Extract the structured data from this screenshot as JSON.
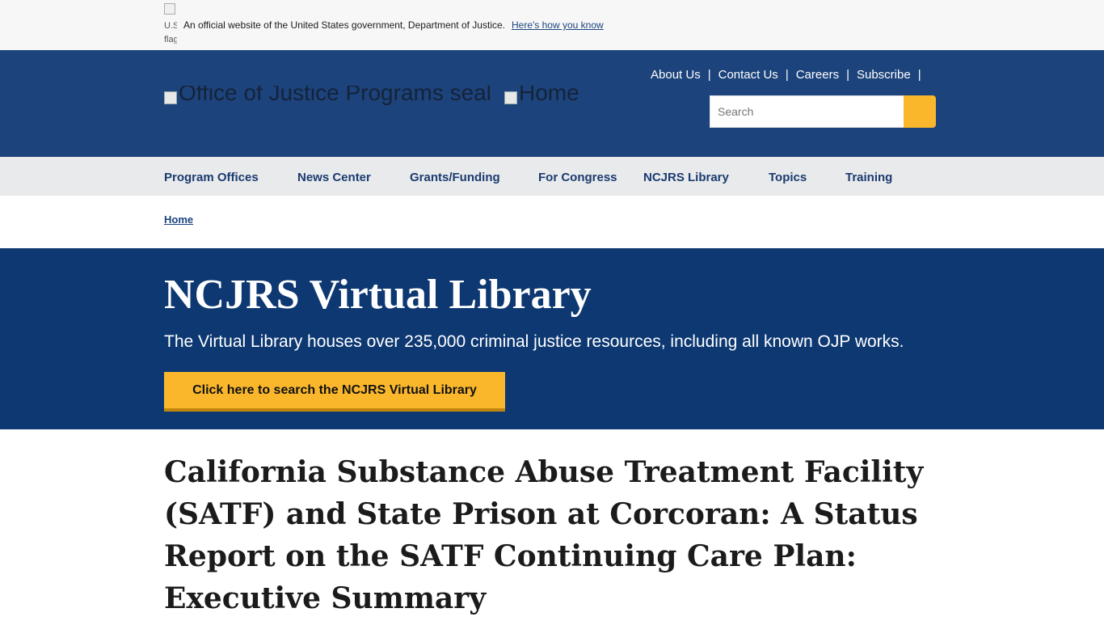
{
  "gov_banner": {
    "flag_alt": "U.S. flag",
    "official_text": "An official website of the United States government, Department of Justice.",
    "how_link": "Here's how you know"
  },
  "header": {
    "utility_links": [
      "About Us",
      "Contact Us",
      "Careers",
      "Subscribe"
    ],
    "logo_alt": "Office of Justice Programs seal",
    "home_alt": "Home",
    "search_placeholder": "Search",
    "colors": {
      "header_bg": "#1c437b",
      "accent": "#fab72c"
    }
  },
  "main_nav": {
    "items": [
      "Program Offices",
      "News Center",
      "Grants/Funding",
      "For Congress",
      "NCJRS Library",
      "Topics",
      "Training"
    ]
  },
  "breadcrumb": {
    "home": "Home"
  },
  "hero": {
    "title": "NCJRS Virtual Library",
    "description": "The Virtual Library houses over 235,000 criminal justice resources, including all known OJP works.",
    "cta_label": "Click here to search the NCJRS Virtual Library"
  },
  "document": {
    "title": "California Substance Abuse Treatment Facility (SATF) and State Prison at Corcoran: A Status Report on the SATF Continuing Care Plan: Executive Summary"
  }
}
